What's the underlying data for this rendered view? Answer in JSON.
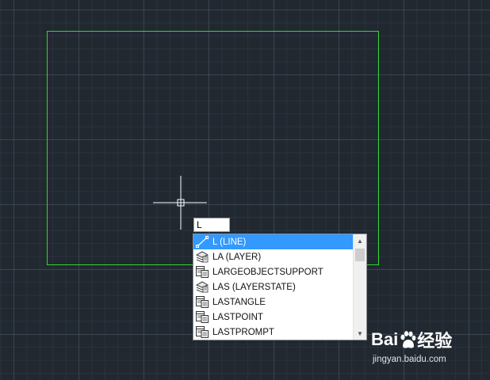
{
  "command_input": {
    "value": "L"
  },
  "autocomplete": {
    "items": [
      {
        "label": "L (LINE)",
        "icon": "line-icon",
        "selected": true
      },
      {
        "label": "LA (LAYER)",
        "icon": "layer-icon",
        "selected": false
      },
      {
        "label": "LARGEOBJECTSUPPORT",
        "icon": "system-variable-icon",
        "selected": false
      },
      {
        "label": "LAS (LAYERSTATE)",
        "icon": "layer-icon",
        "selected": false
      },
      {
        "label": "LASTANGLE",
        "icon": "system-variable-icon",
        "selected": false
      },
      {
        "label": "LASTPOINT",
        "icon": "system-variable-icon",
        "selected": false
      },
      {
        "label": "LASTPROMPT",
        "icon": "system-variable-icon",
        "selected": false
      }
    ],
    "scroll_up_glyph": "▲",
    "scroll_down_glyph": "▼"
  },
  "watermark": {
    "brand_left": "Bai",
    "brand_right": "经验",
    "site": "jingyan.baidu.com"
  },
  "colors": {
    "background": "#212830",
    "rectangle": "#2fd72f",
    "selection": "#3399ff",
    "crosshair": "#ffffff"
  }
}
